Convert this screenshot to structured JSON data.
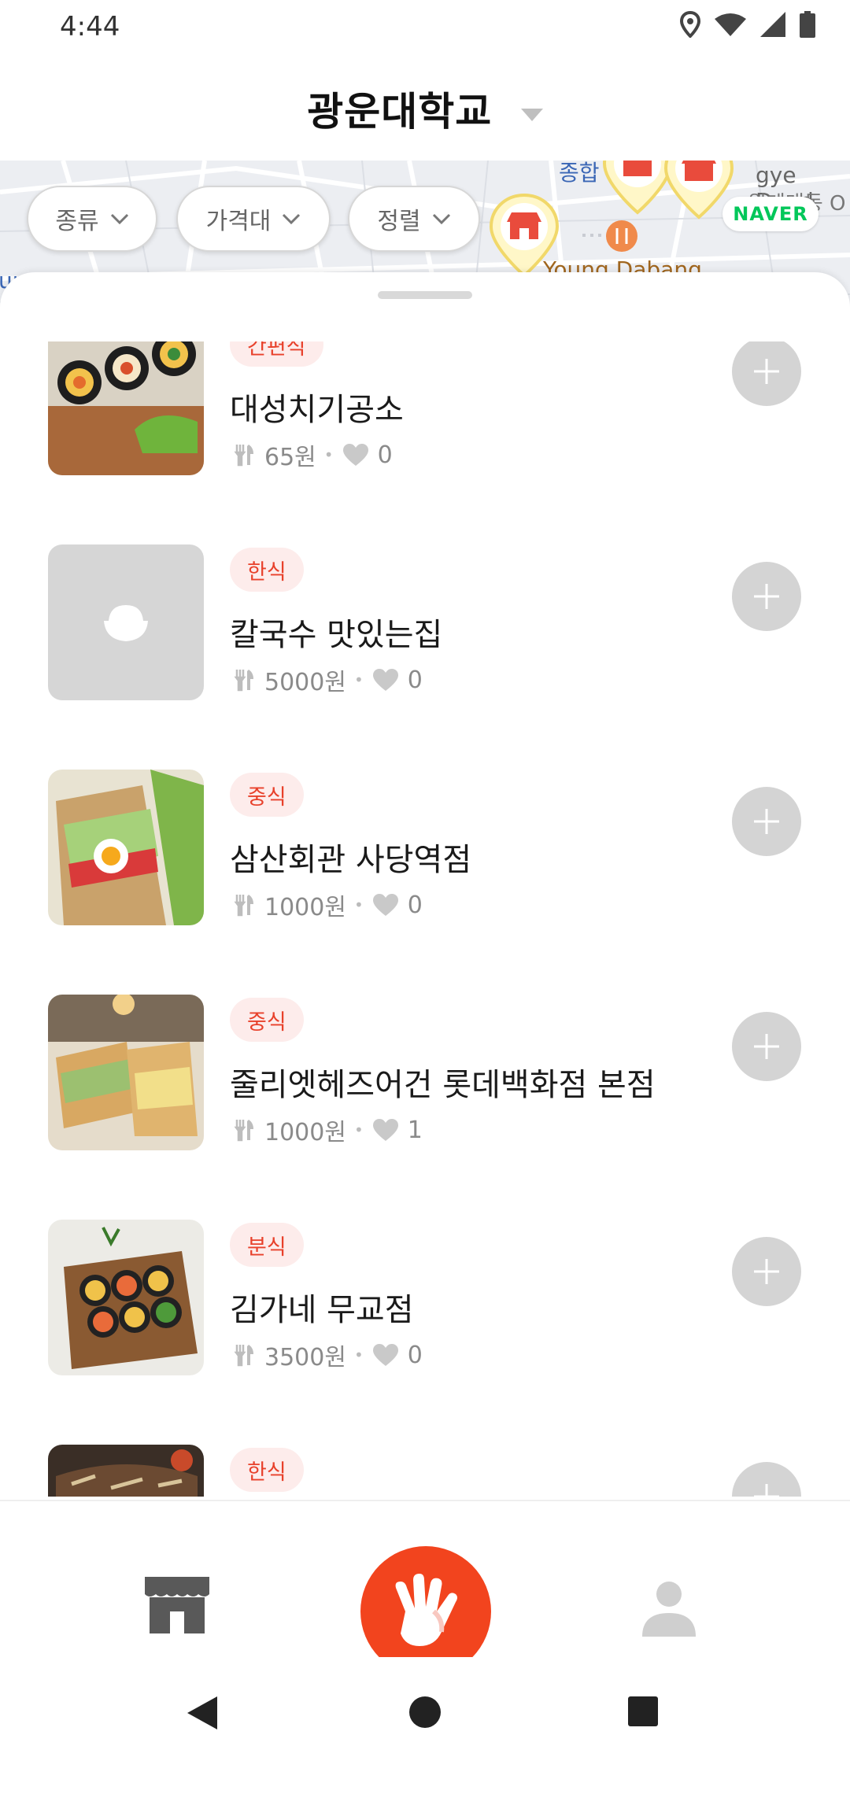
{
  "status_bar": {
    "time": "4:44"
  },
  "header": {
    "title": "광운대학교"
  },
  "map": {
    "labels": {
      "top_left": "종합",
      "right_top": "gye Daed",
      "right_mid": "원계대동 O",
      "bottom": "Young Dabang",
      "left": "un"
    },
    "naver": "NAVER"
  },
  "filters": [
    {
      "label": "종류"
    },
    {
      "label": "가격대"
    },
    {
      "label": "정렬"
    }
  ],
  "restaurants": [
    {
      "category": "간편식",
      "name": "대성치기공소",
      "price": "65원",
      "likes": "0",
      "image": "kimbap-photo"
    },
    {
      "category": "한식",
      "name": "칼국수 맛있는집",
      "price": "5000원",
      "likes": "0",
      "image": "rice-bowl-placeholder"
    },
    {
      "category": "중식",
      "name": "삼산회관 사당역점",
      "price": "1000원",
      "likes": "0",
      "image": "sandwich-photo"
    },
    {
      "category": "중식",
      "name": "줄리엣헤즈어건 롯데백화점 본점",
      "price": "1000원",
      "likes": "1",
      "image": "toast-photo"
    },
    {
      "category": "분식",
      "name": "김가네 무교점",
      "price": "3500원",
      "likes": "0",
      "image": "kimbap-plate-photo"
    },
    {
      "category": "한식",
      "name": "",
      "price": "",
      "likes": "",
      "image": "bulgogi-photo"
    }
  ],
  "bottom_nav": {
    "items": [
      "store-icon",
      "hand-icon",
      "profile-icon"
    ],
    "accent": "#f2441e"
  },
  "system_nav": [
    "back-icon",
    "home-icon",
    "recents-icon"
  ],
  "colors": {
    "accent": "#f2441e",
    "badge_bg": "#fdeceb",
    "badge_text": "#e8412b",
    "naver_green": "#03c75a"
  }
}
